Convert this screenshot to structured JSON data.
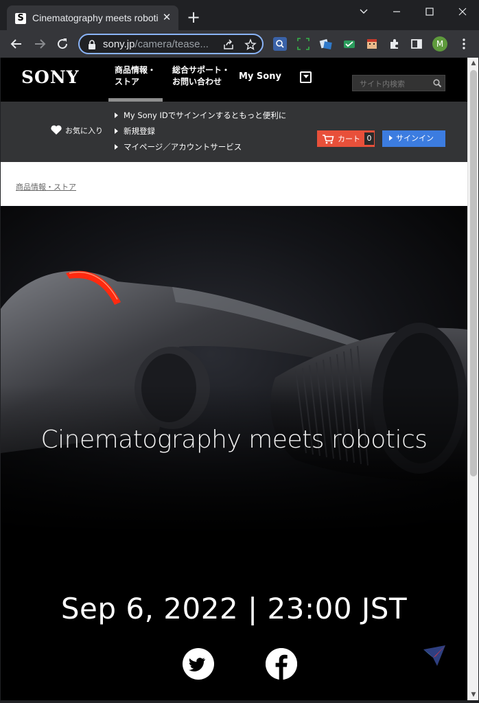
{
  "browser": {
    "tab_title": "Cinematography meets robotics",
    "tab_favicon_letter": "S",
    "new_tab_symbol": "+",
    "profile_initial": "M",
    "url_host": "sony.jp",
    "url_path": "/camera/tease...",
    "icons": [
      "back-icon",
      "forward-icon",
      "reload-icon",
      "lock-icon",
      "share-icon",
      "bookmark-star-icon",
      "extensions-icon",
      "side-panel-icon",
      "more-menu-icon"
    ]
  },
  "site": {
    "logo": "SONY",
    "nav": {
      "products_line1": "商品情報・",
      "products_line2": "ストア",
      "support_line1": "総合サポート・",
      "support_line2": "お問い合わせ",
      "mysony": "My Sony"
    },
    "search_placeholder": "サイト内検索",
    "favorites": "お気に入り",
    "user_links": [
      "My Sony IDでサインインするともっと便利に",
      "新規登録",
      "マイページ／アカウントサービス"
    ],
    "cart_label": "カート",
    "cart_count": "0",
    "signin": "サインイン",
    "breadcrumb": "商品情報・ストア",
    "colors": {
      "cart": "#e8503a",
      "signin": "#3c7ce0",
      "accent_red": "#ff2a10"
    }
  },
  "hero": {
    "headline": "Cinematography meets robotics",
    "date": "Sep 6, 2022 |  23:00 JST",
    "social": [
      "twitter-icon",
      "facebook-icon"
    ]
  }
}
